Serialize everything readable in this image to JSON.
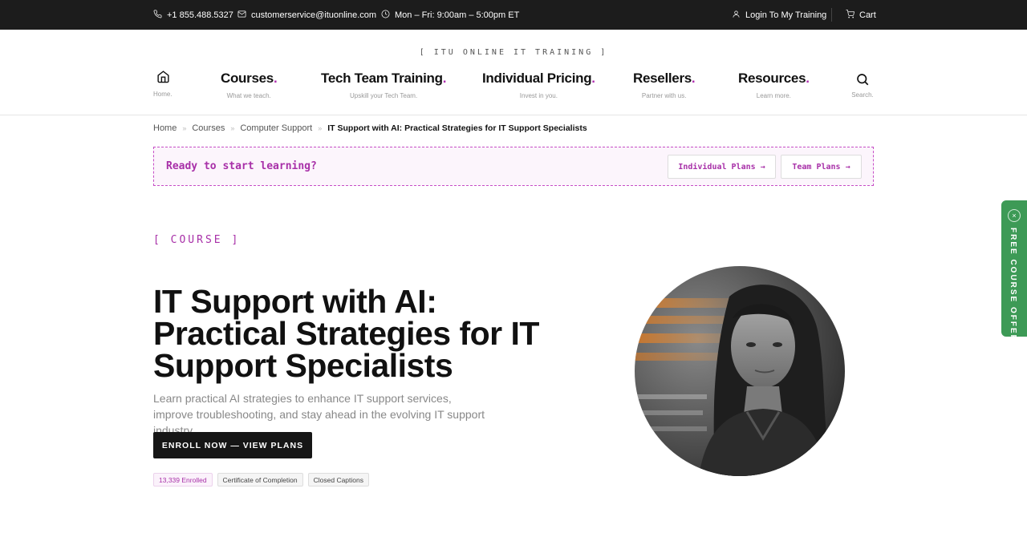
{
  "topbar": {
    "phone": "+1 855.488.5327",
    "email": "customerservice@ituonline.com",
    "hours": "Mon – Fri: 9:00am – 5:00pm ET",
    "login": "Login To My Training",
    "cart": "Cart"
  },
  "header": {
    "kicker": "[ ITU ONLINE IT TRAINING ]",
    "home_label": "Home.",
    "search_label": "Search.",
    "nav": [
      {
        "title": "Courses",
        "dot": ".",
        "sub": "What we teach."
      },
      {
        "title": "Tech Team Training",
        "dot": ".",
        "sub": "Upskill your Tech Team."
      },
      {
        "title": "Individual Pricing",
        "dot": ".",
        "sub": "Invest in you."
      },
      {
        "title": "Resellers",
        "dot": ".",
        "sub": "Partner with us."
      },
      {
        "title": "Resources",
        "dot": ".",
        "sub": "Learn more."
      }
    ]
  },
  "breadcrumb": {
    "items": [
      "Home",
      "Courses",
      "Computer Support"
    ],
    "separator": "»",
    "current": "IT Support with AI: Practical Strategies for IT Support Specialists"
  },
  "banner": {
    "prompt": "Ready to start learning?",
    "individual_plans": "Individual Plans →",
    "team_plans": "Team Plans →"
  },
  "hero": {
    "tag": "[ COURSE ]",
    "title": "IT Support with AI: Practical Strategies for IT Support Specialists",
    "description": "Learn practical AI strategies to enhance IT support services, improve troubleshooting, and stay ahead in the evolving IT support industry.",
    "cta": "ENROLL NOW — VIEW PLANS",
    "badges": [
      "13,339 Enrolled",
      "Certificate of Completion",
      "Closed Captions"
    ]
  },
  "sidetab": {
    "close": "×",
    "label": "FREE COURSE OFFERS"
  },
  "colors": {
    "accent": "#a830a8",
    "topbar_bg": "#1c1c1c",
    "sidetab_bg": "#3d9a56",
    "cta_bg": "#161616"
  }
}
